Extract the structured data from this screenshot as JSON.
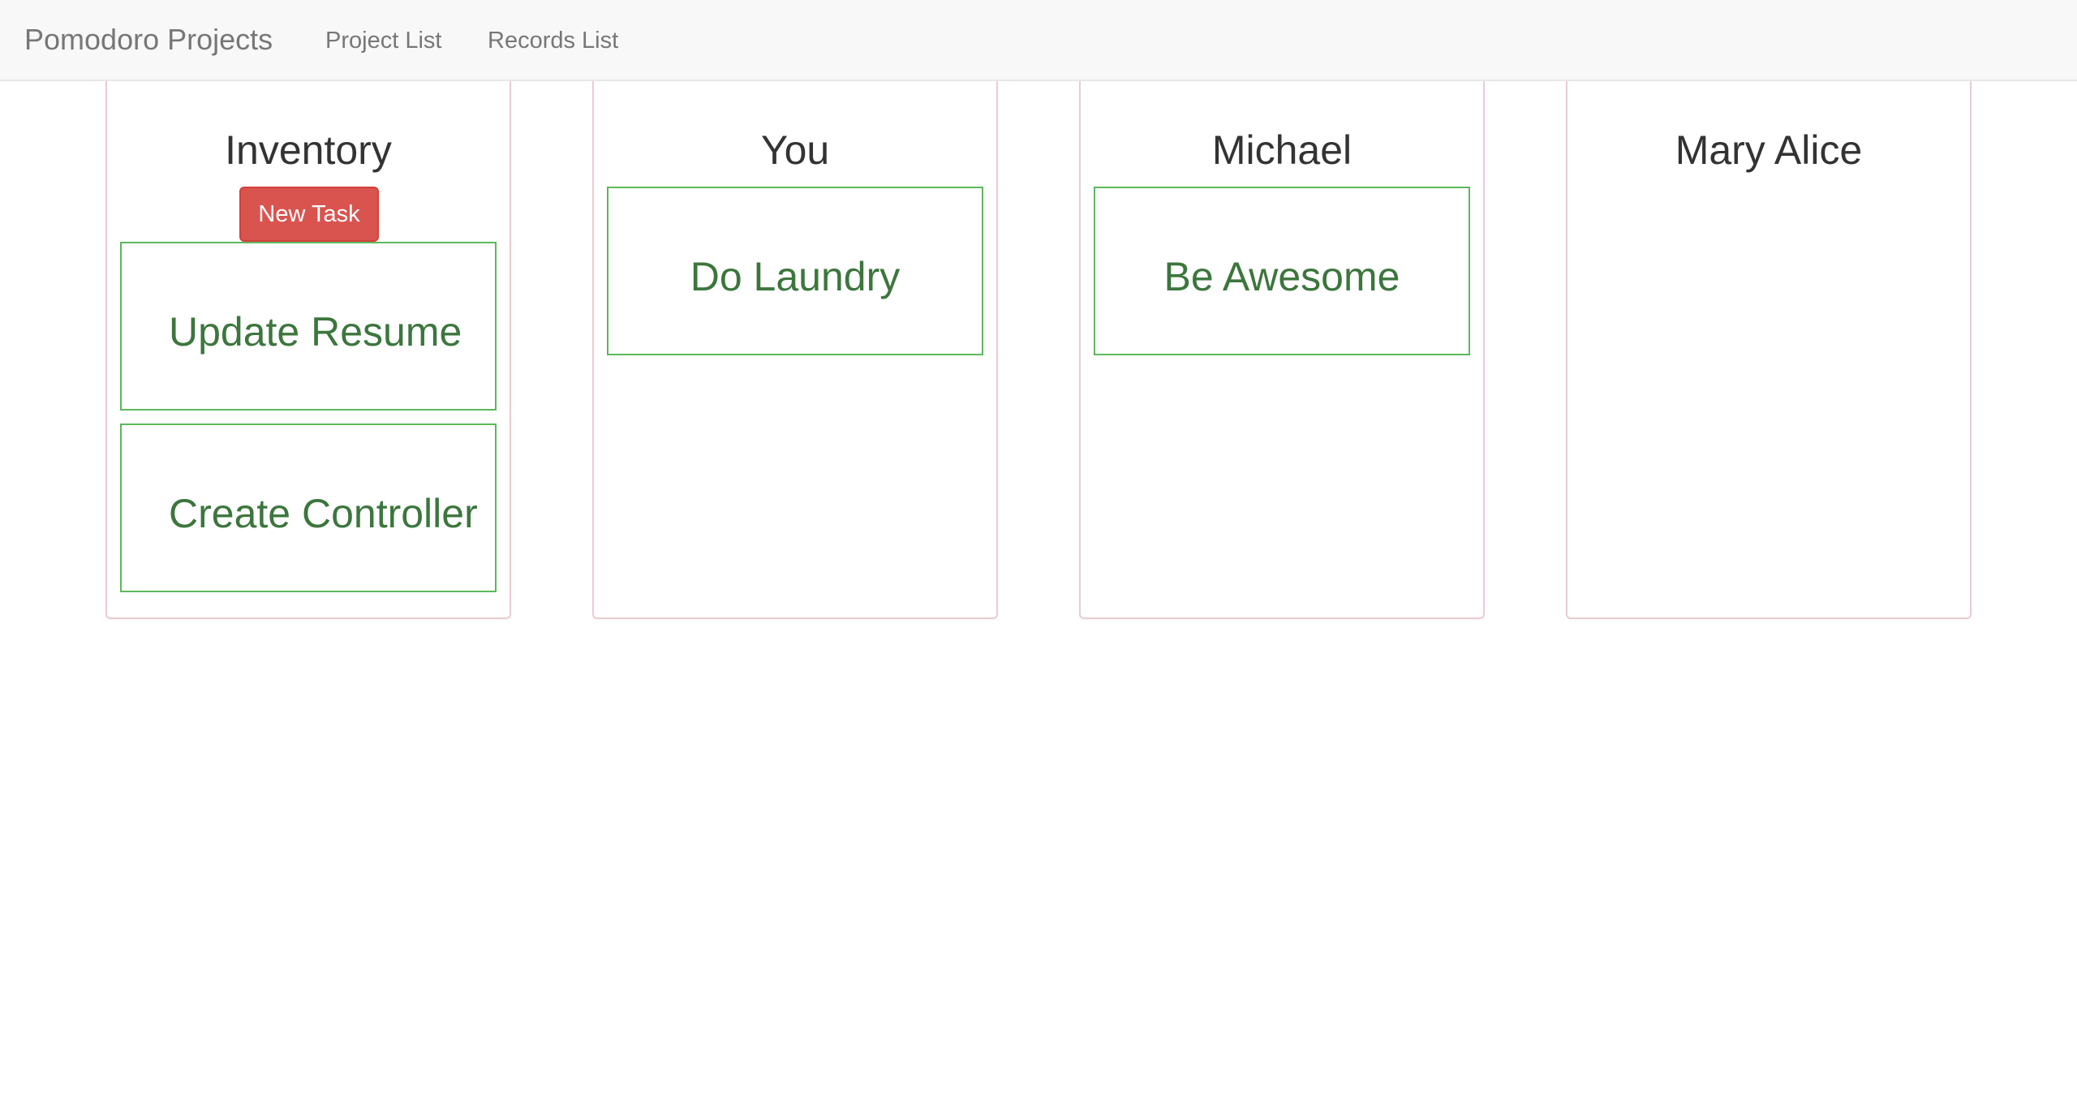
{
  "navbar": {
    "brand": "Pomodoro Projects",
    "links": [
      {
        "label": "Project List"
      },
      {
        "label": "Records List"
      }
    ]
  },
  "columns": [
    {
      "title": "Inventory",
      "button_label": "New Task",
      "tasks": [
        {
          "title": "Update Resume"
        },
        {
          "title": "Create Controller"
        }
      ]
    },
    {
      "title": "You",
      "tasks": [
        {
          "title": "Do Laundry"
        }
      ]
    },
    {
      "title": "Michael",
      "tasks": [
        {
          "title": "Be Awesome"
        }
      ]
    },
    {
      "title": "Mary Alice",
      "tasks": []
    }
  ],
  "colors": {
    "navbar_bg": "#f8f8f8",
    "brand_text": "#777777",
    "column_border": "#ebccd1",
    "task_border": "#5cb85c",
    "task_text": "#3c763d",
    "danger_button": "#d9534f"
  }
}
